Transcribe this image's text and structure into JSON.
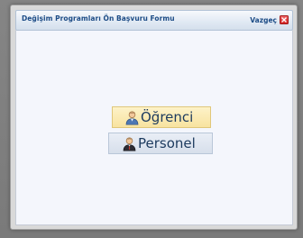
{
  "dialog": {
    "title": "Değişim Programları Ön Başvuru Formu",
    "cancel_label": "Vazgeç",
    "close_icon": "close-icon"
  },
  "options": {
    "student": {
      "label": "Öğrenci",
      "icon": "student-user-icon"
    },
    "staff": {
      "label": "Personel",
      "icon": "staff-user-icon"
    }
  },
  "colors": {
    "title_text": "#1d4c86",
    "student_bg": "#fbeab4",
    "staff_bg": "#dfe6f1",
    "close_red": "#d42525"
  }
}
